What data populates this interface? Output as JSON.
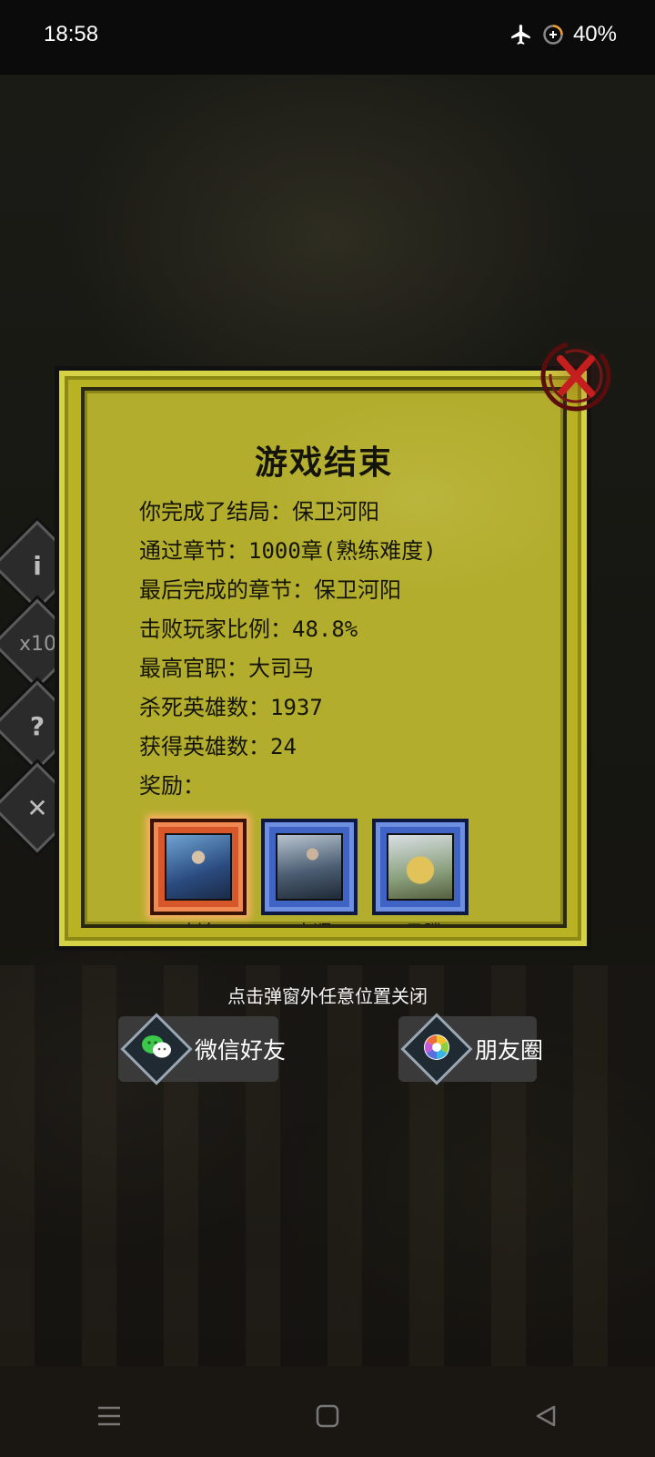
{
  "status_bar": {
    "time": "18:58",
    "battery": "40%"
  },
  "side_buttons": [
    "i",
    "x10",
    "?",
    "✕"
  ],
  "dialog": {
    "title": "游戏结束",
    "lines": [
      "你完成了结局：保卫河阳",
      "通过章节：1000章(熟练难度)",
      "最后完成的章节：保卫河阳",
      "击败玩家比例：48.8%",
      "最高官职：大司马",
      "杀死英雄数：1937",
      "获得英雄数：24",
      "奖励："
    ],
    "rewards": [
      {
        "name": "刘备",
        "highlight": true
      },
      {
        "name": "高顺",
        "highlight": false
      },
      {
        "name": "马腾",
        "highlight": false
      }
    ]
  },
  "hint": "点击弹窗外任意位置关闭",
  "share": {
    "wechat_label": "微信好友",
    "moments_label": "朋友圈"
  },
  "colors": {
    "dialog_bg": "#b2ad2c",
    "reward_blue": "#3f64c6",
    "reward_orange": "#d7572a"
  },
  "icons": [
    "airplane-mode-icon",
    "battery-icon",
    "close-icon",
    "wechat-icon",
    "moments-icon",
    "menu-nav-icon",
    "home-nav-icon",
    "back-nav-icon"
  ]
}
